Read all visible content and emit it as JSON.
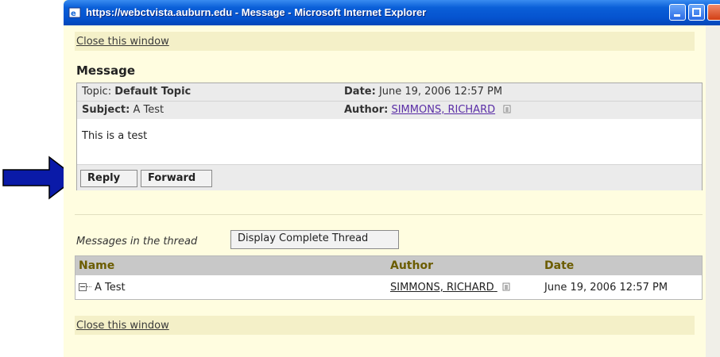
{
  "window": {
    "title": "https://webctvista.auburn.edu - Message - Microsoft Internet Explorer",
    "close_link": "Close this window"
  },
  "message": {
    "heading": "Message",
    "topic_label": "Topic:",
    "topic_value": "Default Topic",
    "date_label": "Date:",
    "date_value": "June 19, 2006 12:57 PM",
    "subject_label": "Subject:",
    "subject_value": "A Test",
    "author_label": "Author:",
    "author_value": "SIMMONS, RICHARD",
    "body": "This is a test",
    "reply_label": "Reply",
    "forward_label": "Forward"
  },
  "thread": {
    "label": "Messages in the thread",
    "display_button": "Display Complete Thread",
    "columns": [
      "Name",
      "Author",
      "Date"
    ],
    "rows": [
      {
        "name": "A Test",
        "author": "SIMMONS, RICHARD",
        "date": "June 19, 2006 12:57 PM"
      }
    ]
  },
  "colors": {
    "titlebar": "#0553cf",
    "page_bg": "#fffde0",
    "arrow": "#0a1aa8",
    "header_text": "#6b5c00",
    "link": "#5a2ea6"
  },
  "icons": [
    "ie-icon",
    "minimize-icon",
    "maximize-icon",
    "close-icon",
    "vcard-icon",
    "expand-icon",
    "pointer-arrow"
  ]
}
